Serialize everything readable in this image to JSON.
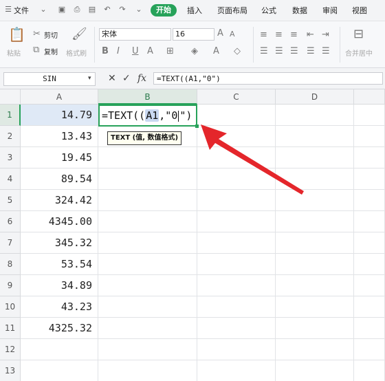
{
  "menubar": {
    "file_label": "文件",
    "tabs": [
      "开始",
      "插入",
      "页面布局",
      "公式",
      "数据",
      "审阅",
      "视图"
    ]
  },
  "ribbon": {
    "paste_label": "粘贴",
    "cut_label": "剪切",
    "copy_label": "复制",
    "format_painter_label": "格式刷",
    "font_name": "宋体",
    "font_size": "16",
    "merge_label": "合并居中"
  },
  "formula_bar": {
    "name_box": "SIN",
    "fx_label": "fx",
    "formula": "=TEXT((A1,\"0\")"
  },
  "sheet": {
    "columns": [
      "A",
      "B",
      "C",
      "D"
    ],
    "rows": [
      "1",
      "2",
      "3",
      "4",
      "5",
      "6",
      "7",
      "8",
      "9",
      "10",
      "11",
      "12",
      "13"
    ],
    "column_a_values": [
      "14.79",
      "13.43",
      "19.45",
      "89.54",
      "324.42",
      "4345.00",
      "345.32",
      "53.54",
      "34.89",
      "43.23",
      "4325.32",
      "",
      ""
    ],
    "edit_prefix": "=TEXT((",
    "edit_ref": "A1",
    "edit_middle": ",\"0",
    "edit_suffix": "\")",
    "tooltip": "TEXT (值, 数值格式)"
  },
  "colors": {
    "accent_green": "#27a25a",
    "arrow_red": "#e4262b"
  }
}
